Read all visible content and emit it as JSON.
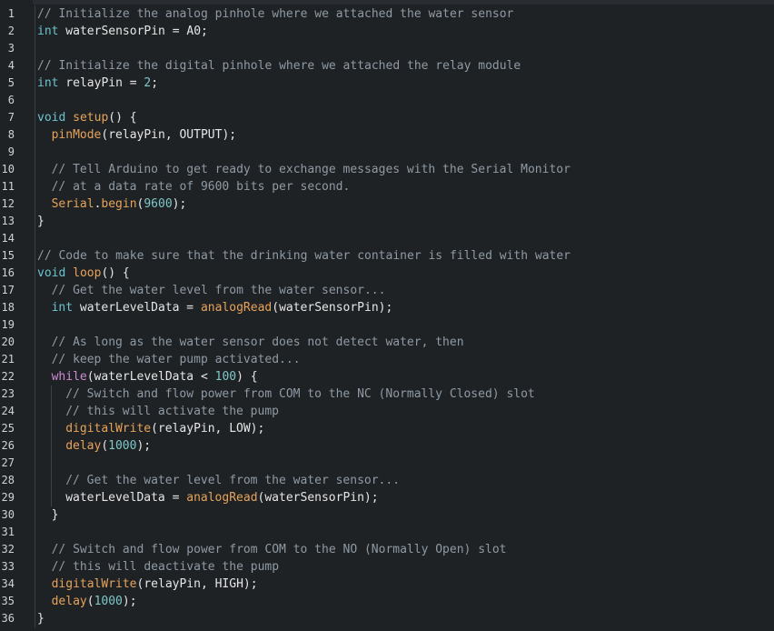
{
  "editor": {
    "colors": {
      "background": "#1f2225",
      "comment": "#8f9aa4",
      "type": "#6cc3cf",
      "keyword": "#cc8ad6",
      "function": "#e7a35a",
      "number": "#7ec7c9",
      "plain": "#e6e6e6",
      "line_number": "#cfd3d6"
    },
    "lines": [
      {
        "n": "1",
        "indent": 0,
        "tokens": [
          {
            "t": "// Initialize the analog pinhole where we attached the water sensor",
            "c": "comment"
          }
        ]
      },
      {
        "n": "2",
        "indent": 0,
        "tokens": [
          {
            "t": "int",
            "c": "type"
          },
          {
            "t": " waterSensorPin = ",
            "c": "plain"
          },
          {
            "t": "A0",
            "c": "plain"
          },
          {
            "t": ";",
            "c": "plain"
          }
        ]
      },
      {
        "n": "3",
        "indent": 0,
        "tokens": []
      },
      {
        "n": "4",
        "indent": 0,
        "tokens": [
          {
            "t": "// Initialize the digital pinhole where we attached the relay module",
            "c": "comment"
          }
        ]
      },
      {
        "n": "5",
        "indent": 0,
        "tokens": [
          {
            "t": "int",
            "c": "type"
          },
          {
            "t": " relayPin = ",
            "c": "plain"
          },
          {
            "t": "2",
            "c": "number"
          },
          {
            "t": ";",
            "c": "plain"
          }
        ]
      },
      {
        "n": "6",
        "indent": 0,
        "tokens": []
      },
      {
        "n": "7",
        "indent": 0,
        "tokens": [
          {
            "t": "void",
            "c": "type"
          },
          {
            "t": " ",
            "c": "plain"
          },
          {
            "t": "setup",
            "c": "function"
          },
          {
            "t": "() {",
            "c": "plain"
          }
        ]
      },
      {
        "n": "8",
        "indent": 1,
        "tokens": [
          {
            "t": "pinMode",
            "c": "function"
          },
          {
            "t": "(relayPin, OUTPUT);",
            "c": "plain"
          }
        ]
      },
      {
        "n": "9",
        "indent": 1,
        "tokens": []
      },
      {
        "n": "10",
        "indent": 1,
        "tokens": [
          {
            "t": "// Tell Arduino to get ready to exchange messages with the Serial Monitor",
            "c": "comment"
          }
        ]
      },
      {
        "n": "11",
        "indent": 1,
        "tokens": [
          {
            "t": "// at a data rate of 9600 bits per second.",
            "c": "comment"
          }
        ]
      },
      {
        "n": "12",
        "indent": 1,
        "tokens": [
          {
            "t": "Serial",
            "c": "function"
          },
          {
            "t": ".",
            "c": "plain"
          },
          {
            "t": "begin",
            "c": "function"
          },
          {
            "t": "(",
            "c": "plain"
          },
          {
            "t": "9600",
            "c": "number"
          },
          {
            "t": ");",
            "c": "plain"
          }
        ]
      },
      {
        "n": "13",
        "indent": 0,
        "tokens": [
          {
            "t": "}",
            "c": "plain"
          }
        ]
      },
      {
        "n": "14",
        "indent": 0,
        "tokens": []
      },
      {
        "n": "15",
        "indent": 0,
        "tokens": [
          {
            "t": "// Code to make sure that the drinking water container is filled with water",
            "c": "comment"
          }
        ]
      },
      {
        "n": "16",
        "indent": 0,
        "tokens": [
          {
            "t": "void",
            "c": "type"
          },
          {
            "t": " ",
            "c": "plain"
          },
          {
            "t": "loop",
            "c": "function"
          },
          {
            "t": "() {",
            "c": "plain"
          }
        ]
      },
      {
        "n": "17",
        "indent": 1,
        "tokens": [
          {
            "t": "// Get the water level from the water sensor...",
            "c": "comment"
          }
        ]
      },
      {
        "n": "18",
        "indent": 1,
        "tokens": [
          {
            "t": "int",
            "c": "type"
          },
          {
            "t": " waterLevelData = ",
            "c": "plain"
          },
          {
            "t": "analogRead",
            "c": "function"
          },
          {
            "t": "(waterSensorPin);",
            "c": "plain"
          }
        ]
      },
      {
        "n": "19",
        "indent": 1,
        "tokens": []
      },
      {
        "n": "20",
        "indent": 1,
        "tokens": [
          {
            "t": "// As long as the water sensor does not detect water, then",
            "c": "comment"
          }
        ]
      },
      {
        "n": "21",
        "indent": 1,
        "tokens": [
          {
            "t": "// keep the water pump activated...",
            "c": "comment"
          }
        ]
      },
      {
        "n": "22",
        "indent": 1,
        "tokens": [
          {
            "t": "while",
            "c": "keyword"
          },
          {
            "t": "(waterLevelData < ",
            "c": "plain"
          },
          {
            "t": "100",
            "c": "number"
          },
          {
            "t": ") {",
            "c": "plain"
          }
        ]
      },
      {
        "n": "23",
        "indent": 2,
        "tokens": [
          {
            "t": "// Switch and flow power from COM to the NC (Normally Closed) slot",
            "c": "comment"
          }
        ]
      },
      {
        "n": "24",
        "indent": 2,
        "tokens": [
          {
            "t": "// this will activate the pump",
            "c": "comment"
          }
        ]
      },
      {
        "n": "25",
        "indent": 2,
        "tokens": [
          {
            "t": "digitalWrite",
            "c": "function"
          },
          {
            "t": "(relayPin, LOW);",
            "c": "plain"
          }
        ]
      },
      {
        "n": "26",
        "indent": 2,
        "tokens": [
          {
            "t": "delay",
            "c": "function"
          },
          {
            "t": "(",
            "c": "plain"
          },
          {
            "t": "1000",
            "c": "number"
          },
          {
            "t": ");",
            "c": "plain"
          }
        ]
      },
      {
        "n": "27",
        "indent": 2,
        "tokens": []
      },
      {
        "n": "28",
        "indent": 2,
        "tokens": [
          {
            "t": "// Get the water level from the water sensor...",
            "c": "comment"
          }
        ]
      },
      {
        "n": "29",
        "indent": 2,
        "tokens": [
          {
            "t": "waterLevelData = ",
            "c": "plain"
          },
          {
            "t": "analogRead",
            "c": "function"
          },
          {
            "t": "(waterSensorPin);",
            "c": "plain"
          }
        ]
      },
      {
        "n": "30",
        "indent": 1,
        "tokens": [
          {
            "t": "}",
            "c": "plain"
          }
        ]
      },
      {
        "n": "31",
        "indent": 1,
        "tokens": []
      },
      {
        "n": "32",
        "indent": 1,
        "tokens": [
          {
            "t": "// Switch and flow power from COM to the NO (Normally Open) slot",
            "c": "comment"
          }
        ]
      },
      {
        "n": "33",
        "indent": 1,
        "tokens": [
          {
            "t": "// this will deactivate the pump",
            "c": "comment"
          }
        ]
      },
      {
        "n": "34",
        "indent": 1,
        "tokens": [
          {
            "t": "digitalWrite",
            "c": "function"
          },
          {
            "t": "(relayPin, HIGH);",
            "c": "plain"
          }
        ]
      },
      {
        "n": "35",
        "indent": 1,
        "tokens": [
          {
            "t": "delay",
            "c": "function"
          },
          {
            "t": "(",
            "c": "plain"
          },
          {
            "t": "1000",
            "c": "number"
          },
          {
            "t": ");",
            "c": "plain"
          }
        ]
      },
      {
        "n": "36",
        "indent": 0,
        "tokens": [
          {
            "t": "}",
            "c": "plain"
          }
        ]
      }
    ]
  }
}
